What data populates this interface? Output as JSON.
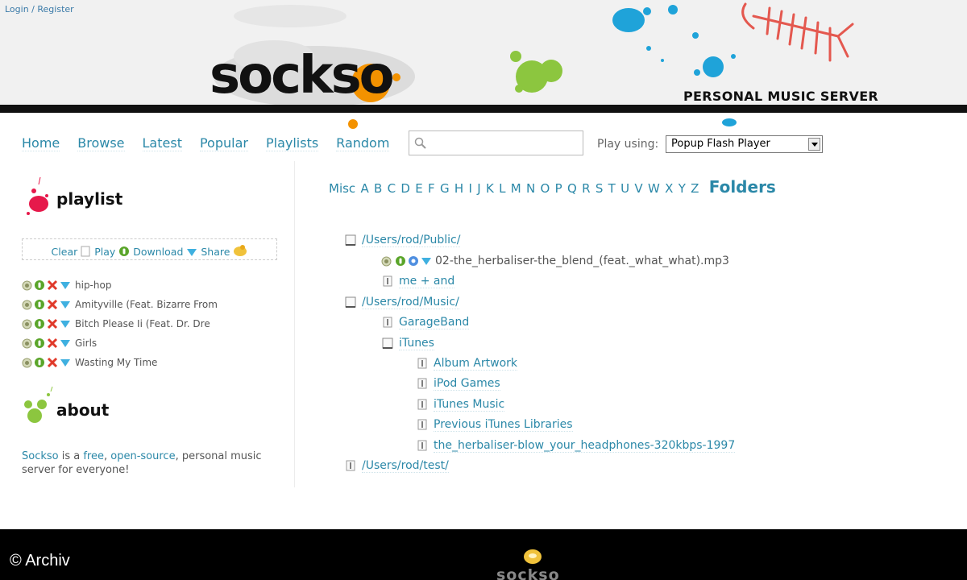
{
  "header": {
    "auth": {
      "login": "Login",
      "sep": " / ",
      "register": "Register"
    },
    "logo": "sockso",
    "tagline": "PERSONAL MUSIC SERVER"
  },
  "nav": {
    "items": [
      "Home",
      "Browse",
      "Latest",
      "Popular",
      "Playlists",
      "Random"
    ],
    "search": {
      "value": "",
      "placeholder": ""
    },
    "play_using_label": "Play using:",
    "player_select": "Popup Flash Player"
  },
  "playlist": {
    "title": "playlist",
    "actions": {
      "clear": "Clear",
      "play": "Play",
      "download": "Download",
      "share": "Share"
    },
    "items": [
      "hip-hop",
      "Amityville (Feat. Bizarre From",
      "Bitch Please Ii (Feat. Dr. Dre",
      "Girls",
      "Wasting My Time"
    ]
  },
  "about": {
    "title": "about",
    "text_pre": "Sockso",
    "text_mid1": " is a ",
    "link_free": "free",
    "text_mid2": ", ",
    "link_open": "open-source",
    "text_post": ", personal music server for everyone!"
  },
  "browse": {
    "letters": [
      "Misc",
      "A",
      "B",
      "C",
      "D",
      "E",
      "F",
      "G",
      "H",
      "I",
      "J",
      "K",
      "L",
      "M",
      "N",
      "O",
      "P",
      "Q",
      "R",
      "S",
      "T",
      "U",
      "V",
      "W",
      "X",
      "Y",
      "Z"
    ],
    "folders_label": "Folders"
  },
  "tree": {
    "public": "/Users/rod/Public/",
    "public_file": "02-the_herbaliser-the_blend_(feat._what_what).mp3",
    "public_sub": "me + and",
    "music": "/Users/rod/Music/",
    "garageband": "GarageBand",
    "itunes": "iTunes",
    "itunes_children": [
      "Album Artwork",
      "iPod Games",
      "iTunes Music",
      "Previous iTunes Libraries",
      "the_herbaliser-blow_your_headphones-320kbps-1997"
    ],
    "test": "/Users/rod/test/"
  },
  "footer": {
    "copyright": "© Archiv",
    "logo": "sockso"
  },
  "colors": {
    "link": "#2b88a8",
    "header_bg": "#f1f1f1",
    "band": "#111111",
    "footer_bg": "#000000",
    "accent_orange": "#f39200",
    "accent_green": "#8cc63f",
    "accent_blue": "#1fa3d9",
    "accent_pink": "#e6194b"
  }
}
